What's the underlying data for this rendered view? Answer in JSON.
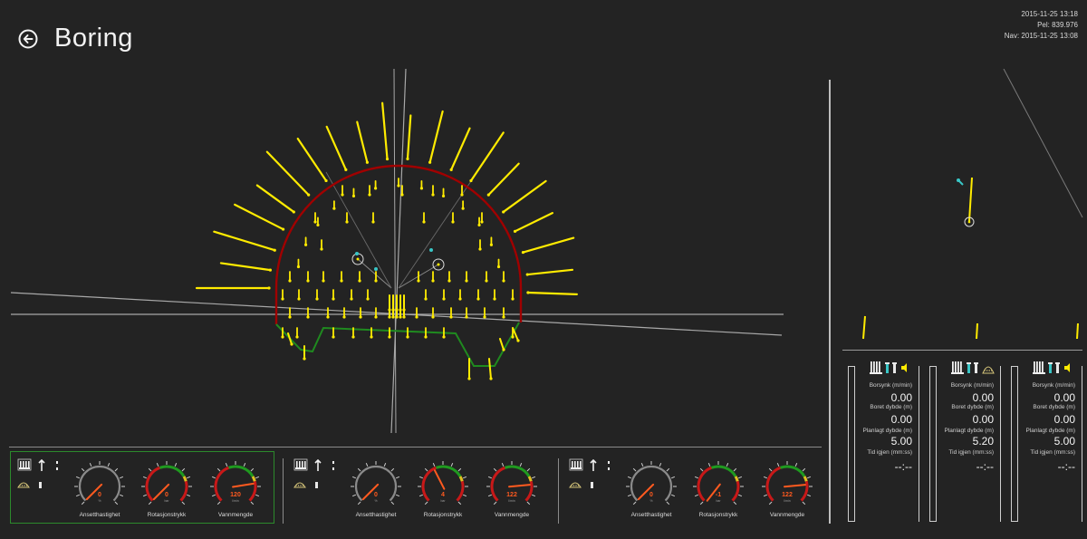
{
  "header": {
    "title": "Boring",
    "back_icon": "back-arrow-icon"
  },
  "status": {
    "datetime": "2015-11-25 13:18",
    "pel": "Pel: 839.976",
    "nav": "Nav: 2015-11-25 13:08"
  },
  "rigs": [
    {
      "active": true,
      "icons": [
        "drill-rig-icon",
        "arrow-up-icon",
        "dots-icon",
        "pattern-icon",
        "bucket-icon"
      ],
      "gauges": [
        {
          "label": "Ansetthastighet",
          "value": "0",
          "unit": "%"
        },
        {
          "label": "Rotasjonstrykk",
          "value": "0",
          "unit": "bar"
        },
        {
          "label": "Vannmengde",
          "value": "120",
          "unit": "l/min"
        }
      ]
    },
    {
      "active": false,
      "icons": [
        "drill-rig-icon",
        "arrow-up-icon",
        "dots-icon",
        "pattern-icon",
        "bucket-icon"
      ],
      "gauges": [
        {
          "label": "Ansetthastighet",
          "value": "0",
          "unit": "%"
        },
        {
          "label": "Rotasjonstrykk",
          "value": "4",
          "unit": "bar"
        },
        {
          "label": "Vannmengde",
          "value": "122",
          "unit": "l/min"
        }
      ]
    },
    {
      "active": false,
      "icons": [
        "drill-rig-icon",
        "arrow-up-icon",
        "dots-icon",
        "pattern-icon",
        "bucket-icon"
      ],
      "gauges": [
        {
          "label": "Ansetthastighet",
          "value": "0",
          "unit": "%"
        },
        {
          "label": "Rotasjonstrykk",
          "value": "-1",
          "unit": "bar"
        },
        {
          "label": "Vannmengde",
          "value": "122",
          "unit": "l/min"
        }
      ]
    }
  ],
  "columns": [
    {
      "rows": [
        {
          "label": "Borsynk (m/min)",
          "value": "0.00"
        },
        {
          "label": "Boret dybde (m)",
          "value": "0.00"
        },
        {
          "label": "Planlagt dybde (m)",
          "value": "5.00"
        },
        {
          "label": "Tid igjen (mm:ss)",
          "value": "--:--"
        }
      ]
    },
    {
      "rows": [
        {
          "label": "Borsynk (m/min)",
          "value": "0.00"
        },
        {
          "label": "Boret dybde (m)",
          "value": "0.00"
        },
        {
          "label": "Planlagt dybde (m)",
          "value": "5.20"
        },
        {
          "label": "Tid igjen (mm:ss)",
          "value": "--:--"
        }
      ]
    },
    {
      "rows": [
        {
          "label": "Borsynk (m/min)",
          "value": "0.00"
        },
        {
          "label": "Boret dybde (m)",
          "value": "0.00"
        },
        {
          "label": "Planlagt dybde (m)",
          "value": "5.00"
        },
        {
          "label": "Tid igjen (mm:ss)",
          "value": "--:--"
        }
      ]
    }
  ],
  "colors": {
    "background": "#232323",
    "drill_hole": "#ffeb00",
    "tunnel_profile": "#a00000",
    "floor_profile": "#1f8a1f",
    "boom_marker": "#39c6c6",
    "gauge_needle": "#ff5a1f",
    "gauge_red": "#c81818",
    "gauge_green": "#1f9a1f",
    "active_border": "#2c8a2c"
  }
}
